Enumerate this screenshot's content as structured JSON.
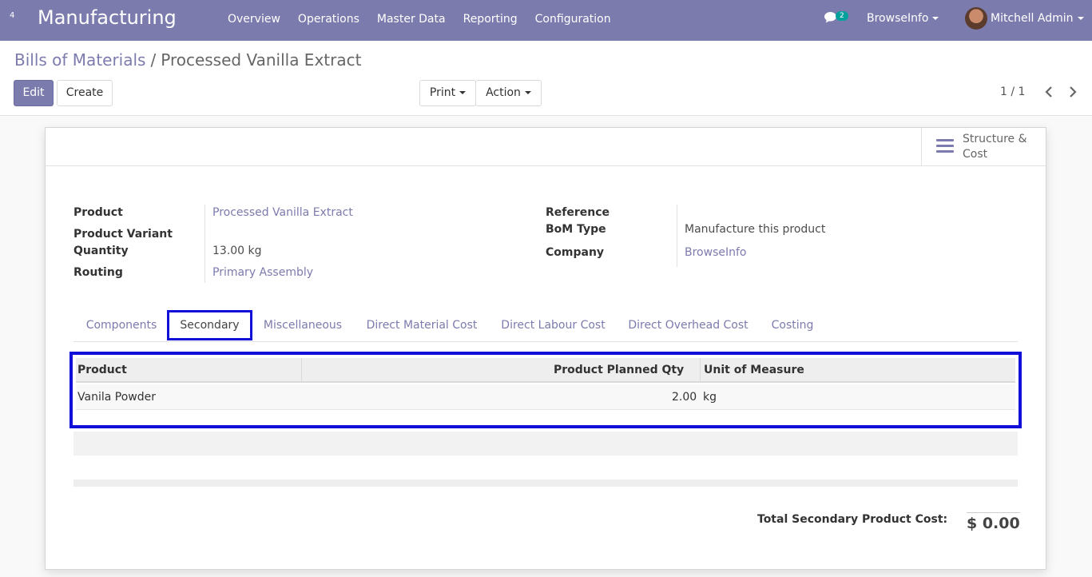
{
  "navbar": {
    "apps_badge": "4",
    "brand": "Manufacturing",
    "menu": [
      "Overview",
      "Operations",
      "Master Data",
      "Reporting",
      "Configuration"
    ],
    "chat_count": "2",
    "company": "BrowseInfo",
    "user": "Mitchell Admin"
  },
  "breadcrumb": {
    "parent": "Bills of Materials",
    "separator": "/",
    "current": "Processed Vanilla Extract"
  },
  "toolbar": {
    "edit_label": "Edit",
    "create_label": "Create",
    "print_label": "Print",
    "action_label": "Action",
    "pager": "1 / 1"
  },
  "stat_button": {
    "label": "Structure & Cost"
  },
  "form": {
    "product_label": "Product",
    "product_value": "Processed Vanilla Extract",
    "variant_label": "Product Variant",
    "quantity_label": "Quantity",
    "quantity_value": "13.00 kg",
    "routing_label": "Routing",
    "routing_value": "Primary Assembly",
    "reference_label": "Reference",
    "bom_type_label": "BoM Type",
    "bom_type_value": "Manufacture this product",
    "company_label": "Company",
    "company_value": "BrowseInfo"
  },
  "tabs": [
    "Components",
    "Secondary",
    "Miscellaneous",
    "Direct Material Cost",
    "Direct Labour Cost",
    "Direct Overhead Cost",
    "Costing"
  ],
  "active_tab": "Secondary",
  "table": {
    "columns": [
      "Product",
      "Product Planned Qty",
      "Unit of Measure"
    ],
    "rows": [
      {
        "product": "Vanila Powder",
        "qty": "2.00",
        "uom": "kg"
      }
    ]
  },
  "total": {
    "label": "Total Secondary Product Cost:",
    "value": "$ 0.00"
  },
  "colors": {
    "brand": "#7c7bad",
    "highlight": "#1010d8",
    "badge": "#00a09d"
  }
}
